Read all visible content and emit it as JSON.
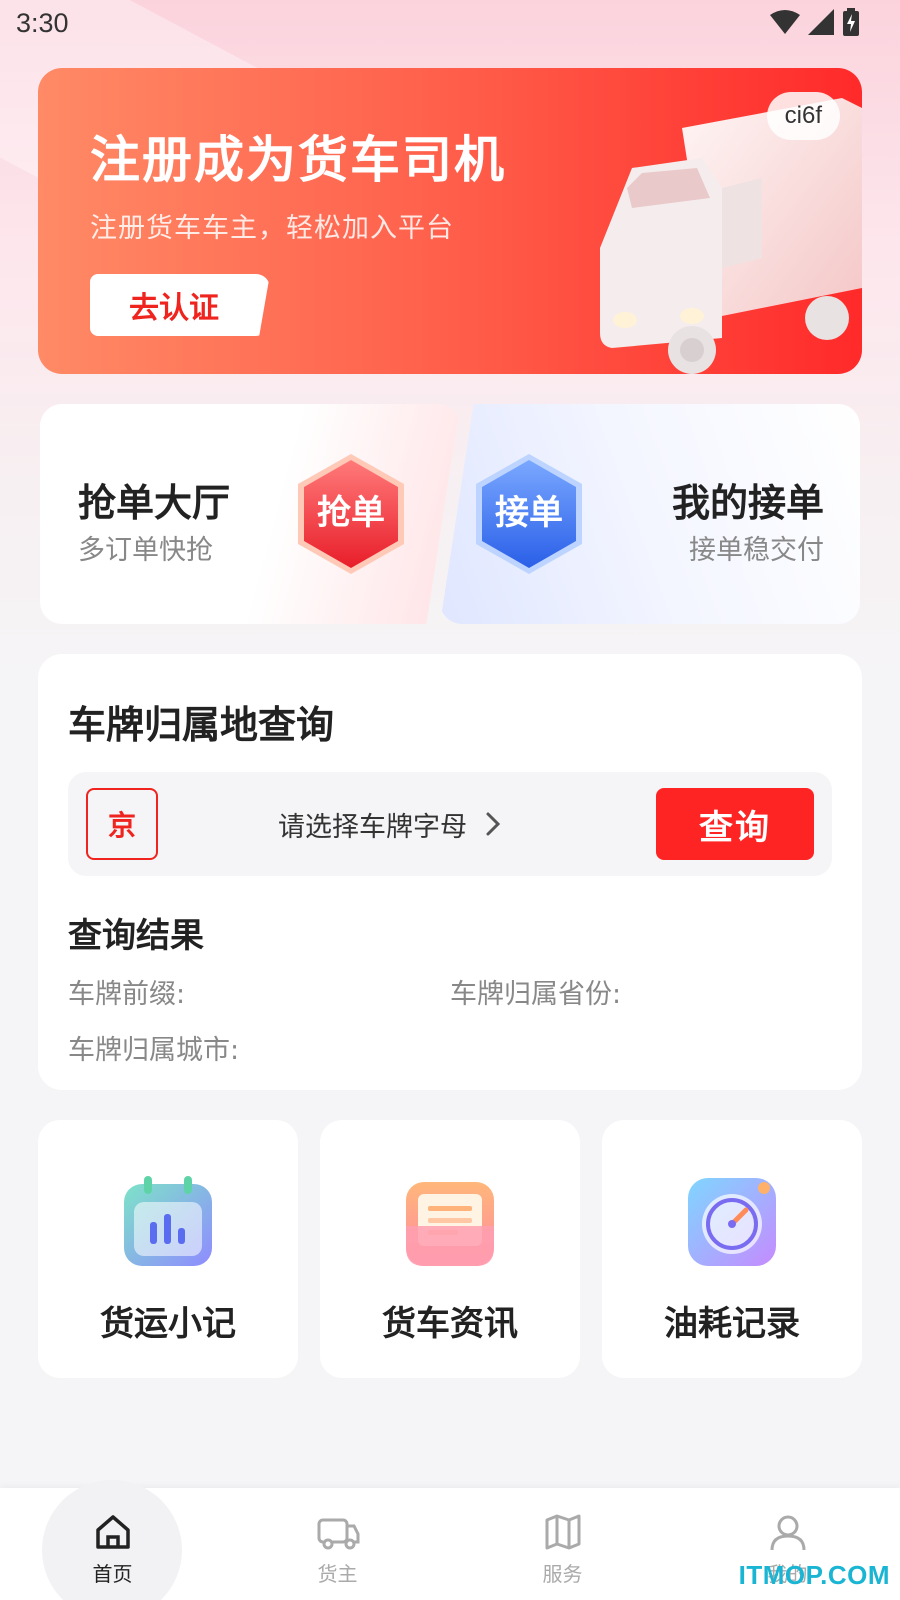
{
  "status_bar": {
    "time": "3:30"
  },
  "banner": {
    "title": "注册成为货车司机",
    "subtitle": "注册货车车主，轻松加入平台",
    "button_label": "去认证",
    "badge": "ci6f"
  },
  "grab_card": {
    "title": "抢单大厅",
    "subtitle": "多订单快抢",
    "icon_text": "抢单"
  },
  "accept_card": {
    "title": "我的接单",
    "subtitle": "接单稳交付",
    "icon_text": "接单"
  },
  "plate_query": {
    "title": "车牌归属地查询",
    "province": "京",
    "letter_placeholder": "请选择车牌字母",
    "query_button": "查询",
    "result_title": "查询结果",
    "prefix_label": "车牌前缀:",
    "province_label": "车牌归属省份:",
    "city_label": "车牌归属城市:"
  },
  "tools": [
    {
      "label": "货运小记",
      "icon": "calendar-chart-icon"
    },
    {
      "label": "货车资讯",
      "icon": "folder-icon"
    },
    {
      "label": "油耗记录",
      "icon": "compass-icon"
    }
  ],
  "bottom_nav": [
    {
      "label": "首页",
      "icon": "home-icon",
      "active": true
    },
    {
      "label": "货主",
      "icon": "truck-icon",
      "active": false
    },
    {
      "label": "服务",
      "icon": "map-icon",
      "active": false
    },
    {
      "label": "我的",
      "icon": "user-icon",
      "active": false
    }
  ],
  "watermark": "ITMOP.COM",
  "colors": {
    "primary_red": "#ff2424",
    "blue": "#3b6ff5"
  }
}
